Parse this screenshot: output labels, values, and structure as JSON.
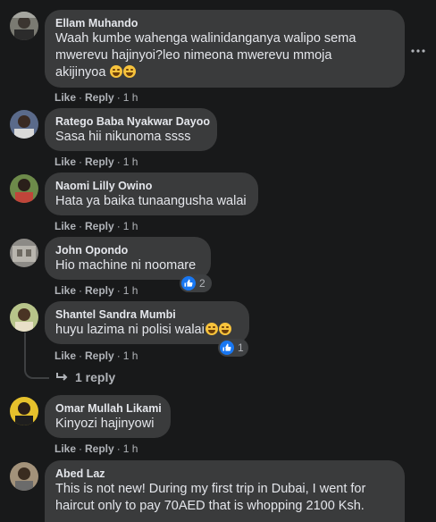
{
  "comments": [
    {
      "author": "Ellam Muhando",
      "lines": [
        "Waah kumbe wahenga walinidanganya walipo sema",
        "mwerevu hajinyoi?leo nimeona mwerevu mmoja",
        "akijinyoa"
      ],
      "emoji_count": 2,
      "like": "Like",
      "reply": "Reply",
      "time": "1 h"
    },
    {
      "author": "Ratego Baba Nyakwar Dayoo",
      "lines": [
        "Sasa hii nikunoma ssss"
      ],
      "like": "Like",
      "reply": "Reply",
      "time": "1 h"
    },
    {
      "author": "Naomi Lilly Owino",
      "lines": [
        "Hata ya baika tunaangusha walai"
      ],
      "like": "Like",
      "reply": "Reply",
      "time": "1 h"
    },
    {
      "author": "John Opondo",
      "lines": [
        "Hio machine ni noomare"
      ],
      "like": "Like",
      "reply": "Reply",
      "time": "1 h",
      "reaction_count": "2"
    },
    {
      "author": "Shantel Sandra Mumbi",
      "lines": [
        "huyu lazima ni polisi walai"
      ],
      "emoji_count": 2,
      "like": "Like",
      "reply": "Reply",
      "time": "1 h",
      "reaction_count": "1"
    },
    {
      "author": "Omar Mullah Likami",
      "lines": [
        "Kinyozi hajinyowi"
      ],
      "like": "Like",
      "reply": "Reply",
      "time": "1 h"
    },
    {
      "author": "Abed Laz",
      "lines": [
        "This is not new! During my first trip in Dubai, I went for",
        "haircut only to pay 70AED that is whopping 2100 Ksh."
      ]
    }
  ],
  "replies_link": "1 reply",
  "colors": {
    "background": "#18191a",
    "bubble": "#3a3b3c",
    "like_blue": "#1877f2",
    "muted": "#b0b3b8"
  },
  "icons": {
    "more": "more-dots-icon",
    "like": "like-thumb-icon",
    "reply": "reply-arrow-icon"
  }
}
